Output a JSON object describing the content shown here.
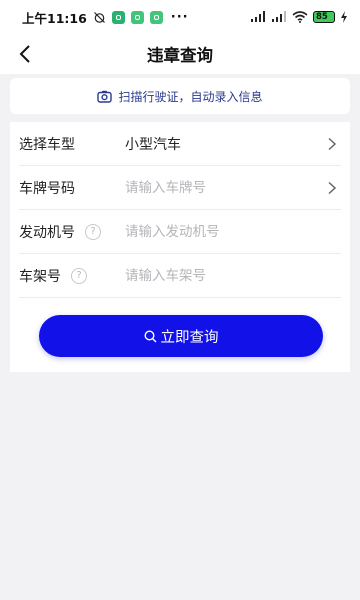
{
  "status_bar": {
    "time": "上午11:16",
    "dots": "···",
    "battery": "85",
    "right_icons": [
      "signal-hd-icon",
      "signal-icon",
      "wifi-icon",
      "battery-icon",
      "charging-icon"
    ]
  },
  "header": {
    "title": "违章查询",
    "back_icon": "chevron-left-icon"
  },
  "scan_banner": {
    "icon": "camera-icon",
    "label": "扫描行驶证，自动录入信息"
  },
  "form": {
    "vehicle_type": {
      "label": "选择车型",
      "value": "小型汽车"
    },
    "plate_number": {
      "label": "车牌号码",
      "placeholder": "请输入车牌号"
    },
    "engine_number": {
      "label": "发动机号",
      "placeholder": "请输入发动机号",
      "help": "?"
    },
    "frame_number": {
      "label": "车架号",
      "placeholder": "请输入车架号",
      "help": "?"
    }
  },
  "query_button": {
    "label": "立即查询",
    "icon": "search-icon"
  },
  "colors": {
    "accent": "#1212e8",
    "scan_text": "#2b3a8f",
    "background": "#f2f2f4",
    "battery_fill": "#41c95d"
  }
}
